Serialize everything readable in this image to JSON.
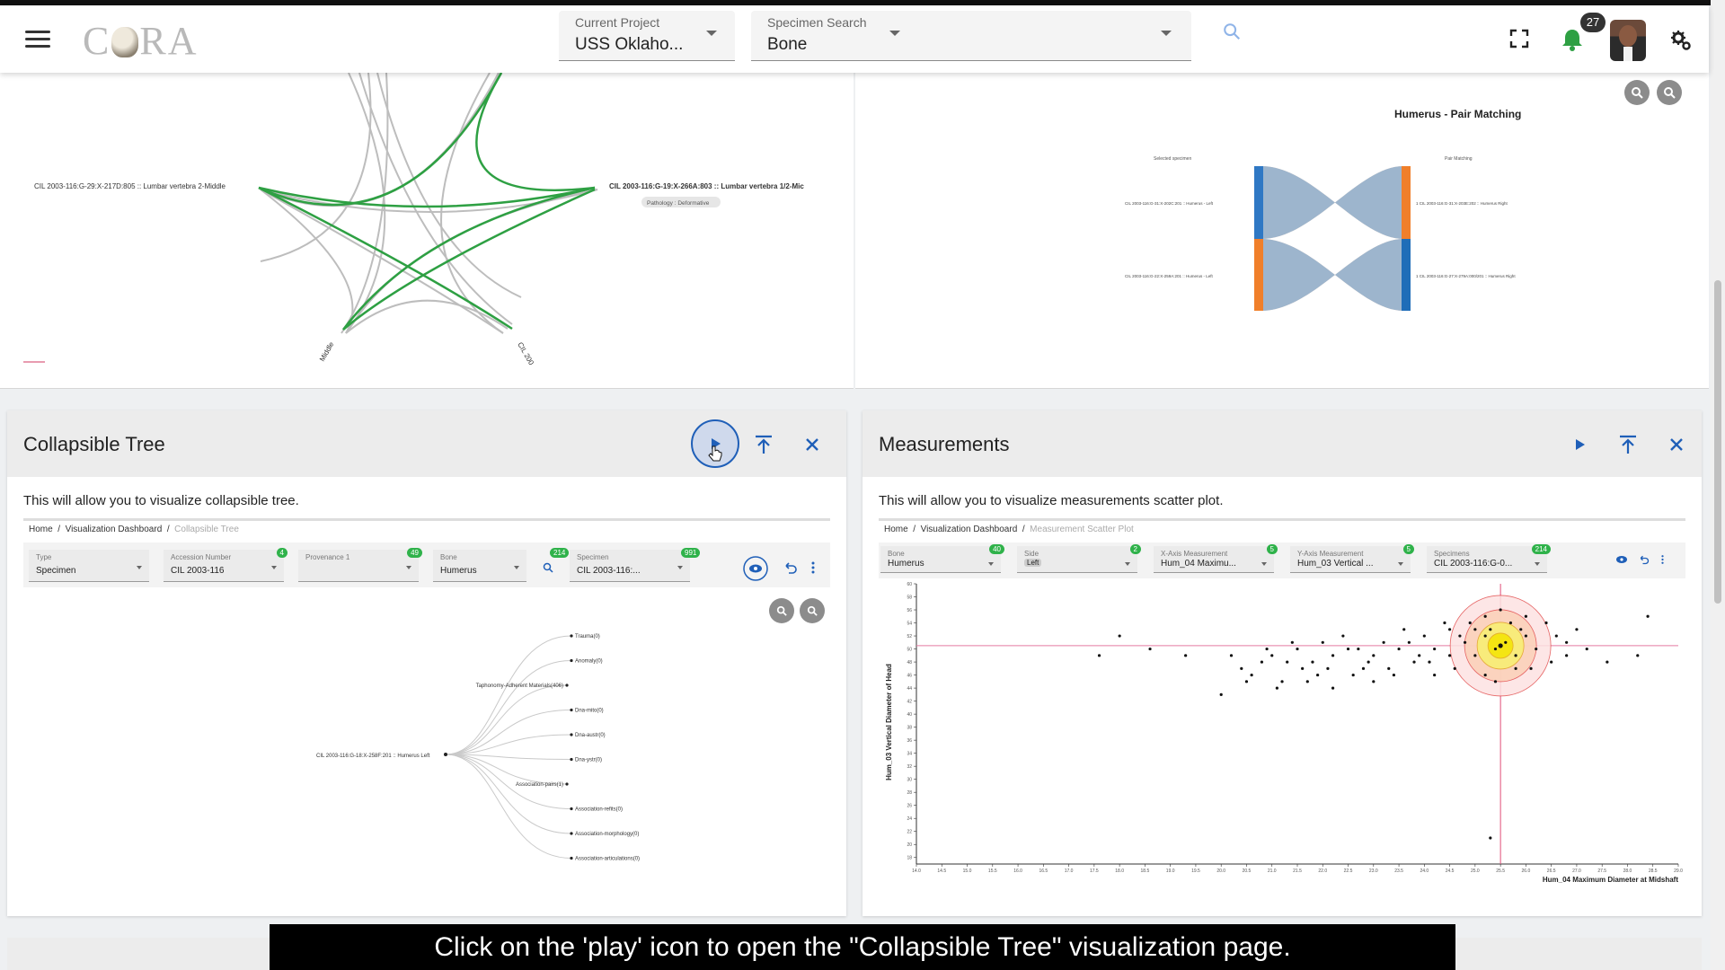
{
  "header": {
    "logo": "CRA",
    "current_project_label": "Current Project",
    "current_project_value": "USS Oklaho...",
    "specimen_search_label": "Specimen Search",
    "specimen_search_value": "Bone",
    "notification_count": "27"
  },
  "top_left_panel": {
    "left_label": "CIL 2003-116:G-29:X-217D:805 :: Lumbar vertebra 2-Middle",
    "right_label": "CIL 2003-116:G-19:X-266A:803 :: Lumbar vertebra 1/2-Mic",
    "pathology_chip": "Pathology : Deformative",
    "bottom_left_label": "Middle",
    "bottom_right_label": "CIL 200"
  },
  "top_right_panel": {
    "title": "Humerus - Pair Matching",
    "left_header": "Selected specimen",
    "right_header": "Pair Matching",
    "left_row1": "CIL 2003-116:G-31:X-202C:201 :: Humerus - Left",
    "left_row2": "CIL 2003-116:G-22:X-259A:201 :: Humerus - Left",
    "right_row1": "1  CIL 2003-116:G-31:X-203E:202 :: Humerus Right",
    "right_row2": "1  CIL 2003-116:G-27:X-279A:000/201 :: Humerus Right"
  },
  "cards": {
    "tree": {
      "title": "Collapsible Tree",
      "description": "This will allow you to visualize collapsible tree.",
      "breadcrumb_home": "Home",
      "breadcrumb_dash": "Visualization Dashboard",
      "breadcrumb_current": "Collapsible Tree",
      "filters": [
        {
          "label": "Type",
          "value": "Specimen",
          "badge": ""
        },
        {
          "label": "Accession Number",
          "value": "CIL 2003-116",
          "badge": "4"
        },
        {
          "label": "Provenance 1",
          "value": "",
          "badge": "49"
        },
        {
          "label": "Bone",
          "value": "Humerus",
          "badge": "214"
        },
        {
          "label": "Specimen",
          "value": "CIL 2003-116:...",
          "badge": "991"
        }
      ],
      "root_label": "CIL 2003-116:G-18:X-258F:201 :: Humerus Left",
      "leaves": [
        "Trauma(0)",
        "Anomaly(0)",
        "Taphonomy-Adherent Materials(406)",
        "Dna-mito(0)",
        "Dna-austr(0)",
        "Dna-ystr(0)",
        "Association-pairs(1)",
        "Association-refits(0)",
        "Association-morphology(0)",
        "Association-articulations(0)"
      ]
    },
    "measure": {
      "title": "Measurements",
      "description": "This will allow you to visualize measurements scatter plot.",
      "breadcrumb_home": "Home",
      "breadcrumb_dash": "Visualization Dashboard",
      "breadcrumb_current": "Measurement Scatter Plot",
      "filters": [
        {
          "label": "Bone",
          "value": "Humerus",
          "badge": "40"
        },
        {
          "label": "Side",
          "value": "Left",
          "badge": "2"
        },
        {
          "label": "X-Axis Measurement",
          "value": "Hum_04 Maximu...",
          "badge": "5"
        },
        {
          "label": "Y-Axis Measurement",
          "value": "Hum_03 Vertical ...",
          "badge": "5"
        },
        {
          "label": "Specimens",
          "value": "CIL 2003-116:G-0...",
          "badge": "214"
        }
      ],
      "ylabel": "Hum_03 Vertical Diameter of Head",
      "xlabel": "Hum_04 Maximum Diameter at Midshaft"
    }
  },
  "chart_data": {
    "type": "scatter",
    "xlabel": "Hum_04 Maximum Diameter at Midshaft",
    "ylabel": "Hum_03 Vertical Diameter of Head",
    "xlim": [
      14.0,
      29.0
    ],
    "ylim": [
      17,
      60
    ],
    "x_ticks": [
      "14.0",
      "14.5",
      "15.0",
      "15.5",
      "16.0",
      "16.5",
      "17.0",
      "17.5",
      "18.0",
      "18.5",
      "19.0",
      "19.5",
      "20.0",
      "20.5",
      "21.0",
      "21.5",
      "22.0",
      "22.5",
      "23.0",
      "23.5",
      "24.0",
      "24.5",
      "25.0",
      "25.5",
      "26.0",
      "26.5",
      "27.0",
      "27.5",
      "28.0",
      "28.5",
      "29.0"
    ],
    "selected_point": {
      "x": 25.5,
      "y": 50.5
    },
    "points": [
      [
        21.0,
        49
      ],
      [
        21.5,
        50
      ],
      [
        21.8,
        48
      ],
      [
        22.0,
        51
      ],
      [
        22.2,
        49
      ],
      [
        22.5,
        50
      ],
      [
        22.8,
        47
      ],
      [
        23.0,
        49
      ],
      [
        23.2,
        51
      ],
      [
        23.5,
        50
      ],
      [
        23.8,
        48
      ],
      [
        24.0,
        52
      ],
      [
        24.2,
        50
      ],
      [
        24.5,
        49
      ],
      [
        24.8,
        51
      ],
      [
        25.0,
        53
      ],
      [
        25.2,
        52
      ],
      [
        25.4,
        50
      ],
      [
        25.6,
        51
      ],
      [
        25.8,
        49
      ],
      [
        26.0,
        52
      ],
      [
        26.2,
        50
      ],
      [
        26.5,
        48
      ],
      [
        26.8,
        51
      ],
      [
        24.6,
        47
      ],
      [
        23.4,
        46
      ],
      [
        22.6,
        46
      ],
      [
        21.6,
        47
      ],
      [
        21.2,
        45
      ],
      [
        20.6,
        46
      ],
      [
        20.4,
        47
      ],
      [
        20.2,
        49
      ],
      [
        20.9,
        50
      ],
      [
        21.4,
        51
      ],
      [
        22.4,
        52
      ],
      [
        23.6,
        53
      ],
      [
        24.4,
        54
      ],
      [
        25.2,
        55
      ],
      [
        26.0,
        55
      ],
      [
        25.5,
        56
      ],
      [
        24.9,
        54
      ],
      [
        26.4,
        54
      ],
      [
        25.8,
        47
      ],
      [
        25.2,
        46
      ],
      [
        24.2,
        46
      ],
      [
        23.0,
        45
      ],
      [
        22.2,
        44
      ],
      [
        21.9,
        46
      ],
      [
        21.3,
        48
      ],
      [
        20.8,
        48
      ],
      [
        19.3,
        49
      ],
      [
        18.0,
        52
      ],
      [
        18.6,
        50
      ],
      [
        17.6,
        49
      ],
      [
        28.2,
        49
      ],
      [
        27.2,
        50
      ],
      [
        27.6,
        48
      ],
      [
        26.8,
        49
      ],
      [
        27.0,
        53
      ],
      [
        28.4,
        55
      ],
      [
        21.7,
        45
      ],
      [
        22.9,
        48
      ],
      [
        23.9,
        49
      ],
      [
        24.7,
        52
      ],
      [
        25.9,
        53
      ],
      [
        26.6,
        52
      ],
      [
        25.0,
        49
      ],
      [
        24.1,
        48
      ],
      [
        23.3,
        47
      ],
      [
        22.7,
        50
      ],
      [
        21.1,
        44
      ],
      [
        20.0,
        43
      ],
      [
        25.4,
        45
      ],
      [
        25.3,
        53
      ],
      [
        25.7,
        54
      ],
      [
        26.1,
        47
      ],
      [
        24.5,
        53
      ],
      [
        23.7,
        51
      ],
      [
        22.1,
        47
      ],
      [
        20.5,
        45
      ],
      [
        25.3,
        21
      ]
    ]
  }
}
